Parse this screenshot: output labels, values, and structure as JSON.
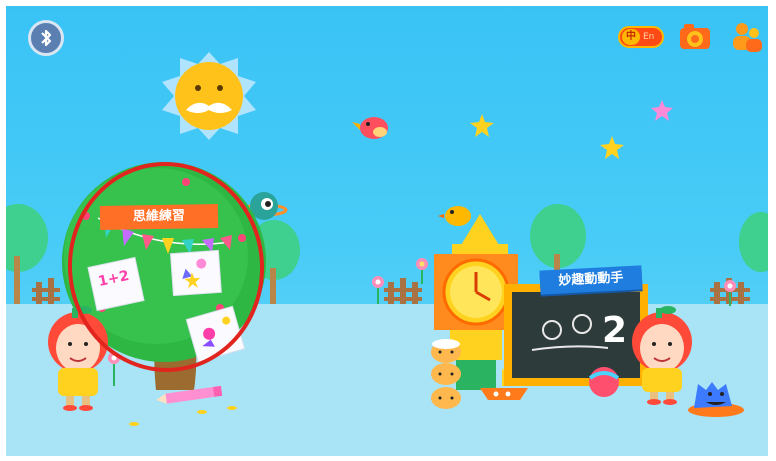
{
  "app": {
    "sections": [
      {
        "label": "思維練習"
      },
      {
        "label": "妙趣動動手"
      }
    ],
    "language_toggle": {
      "zh": "中",
      "en": "En"
    },
    "chalkboard": {
      "number": "2"
    },
    "math_card": {
      "text": "1+2"
    },
    "icons": [
      "bluetooth-icon",
      "language-toggle-icon",
      "camera-icon",
      "users-icon"
    ],
    "colors": {
      "sky": "#39c3f5",
      "highlight_ring": "#e2241f",
      "section1_sign": "#ff6f26",
      "section2_sign": "#1f7de0",
      "lang_toggle": "#ff4a16"
    }
  }
}
